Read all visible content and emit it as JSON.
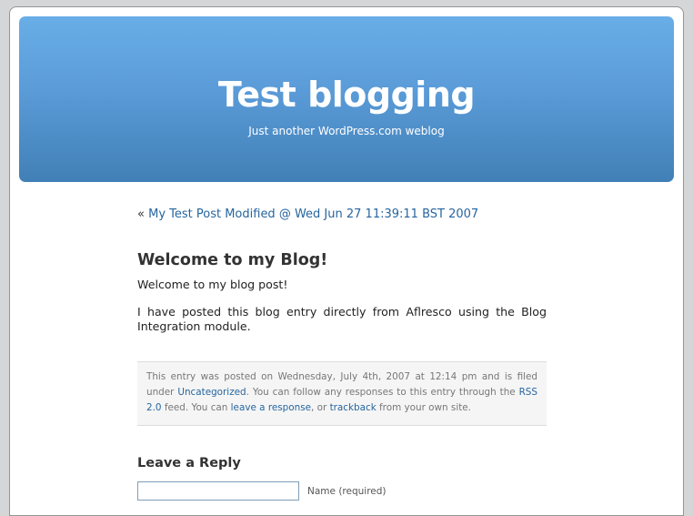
{
  "header": {
    "title": "Test blogging",
    "description": "Just another WordPress.com weblog"
  },
  "navigation": {
    "prev_marker": "«",
    "prev_link": "My Test Post Modified @ Wed Jun 27 11:39:11 BST 2007"
  },
  "post": {
    "title": "Welcome to my Blog!",
    "paragraphs": [
      "Welcome to my blog post!",
      "I have posted this blog entry directly from Aflresco using the Blog Integration module."
    ],
    "meta": {
      "t1": "This entry was posted on Wednesday, July 4th, 2007 at 12:14 pm and is filed under ",
      "category": "Uncategorized",
      "t2": ". You can follow any responses to this entry through the ",
      "rss": "RSS 2.0",
      "t3": " feed. You can ",
      "leave_response": "leave a response",
      "t4": ", or ",
      "trackback": "trackback",
      "t5": " from your own site."
    }
  },
  "reply": {
    "title": "Leave a Reply",
    "name_value": "",
    "name_label": "Name (required)"
  },
  "colors": {
    "link": "#26659f",
    "header_top": "#69aee7",
    "header_bottom": "#4180b6"
  }
}
